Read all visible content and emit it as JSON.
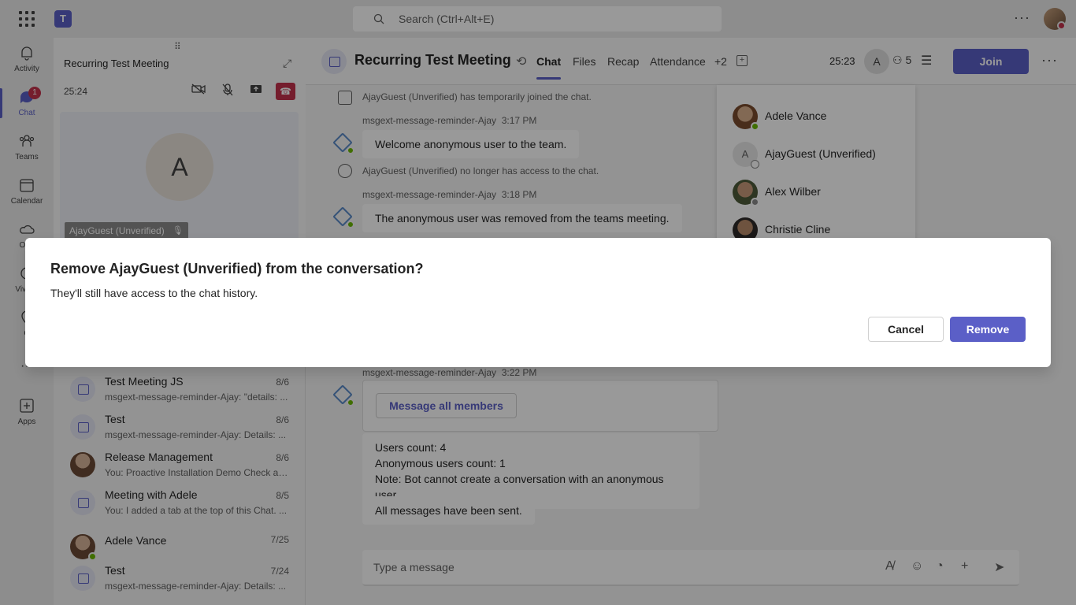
{
  "topbar": {
    "search_placeholder": "Search (Ctrl+Alt+E)",
    "more_label": "···"
  },
  "rail": {
    "items": [
      {
        "label": "Activity",
        "icon": "bell-icon"
      },
      {
        "label": "Chat",
        "icon": "chat-icon",
        "badge": "1"
      },
      {
        "label": "Teams",
        "icon": "teams-icon"
      },
      {
        "label": "Calendar",
        "icon": "calendar-icon"
      },
      {
        "label": "One",
        "icon": "cloud-icon"
      },
      {
        "label": "Viva C",
        "icon": "viva-icon"
      },
      {
        "label": "C",
        "icon": "calls-icon"
      },
      {
        "label": "···",
        "icon": "more-icon"
      },
      {
        "label": "Apps",
        "icon": "apps-icon"
      }
    ]
  },
  "meeting_card": {
    "title": "Recurring Test Meeting",
    "time": "25:24",
    "avatar_initial": "A",
    "participant_name": "AjayGuest (Unverified)"
  },
  "chat_list": [
    {
      "name": "Test Meeting JS",
      "date": "8/6",
      "preview": "msgext-message-reminder-Ajay: \"details: ..."
    },
    {
      "name": "Test",
      "date": "8/6",
      "preview": "msgext-message-reminder-Ajay: Details: ..."
    },
    {
      "name": "Release Management",
      "date": "8/6",
      "preview": "You: Proactive Installation Demo Check an..."
    },
    {
      "name": "Meeting with Adele",
      "date": "8/5",
      "preview": "You: I added a tab at the top of this Chat. ..."
    },
    {
      "name": "Adele Vance",
      "date": "7/25",
      "preview": ""
    },
    {
      "name": "Test",
      "date": "7/24",
      "preview": "msgext-message-reminder-Ajay: Details: ..."
    }
  ],
  "header": {
    "title": "Recurring Test Meeting",
    "tabs": [
      "Chat",
      "Files",
      "Recap",
      "Attendance",
      "+2"
    ],
    "timer": "25:23",
    "avatar_initial": "A",
    "people_count": "5",
    "join_label": "Join"
  },
  "conversation": {
    "sys1": "AjayGuest (Unverified) has temporarily joined the chat.",
    "sender1": "msgext-message-reminder-Ajay",
    "time1": "3:17 PM",
    "msg1": "Welcome anonymous user to the team.",
    "sys2": "AjayGuest (Unverified) no longer has access to the chat.",
    "sender2": "msgext-message-reminder-Ajay",
    "time2": "3:18 PM",
    "msg2": "The anonymous user was removed from the teams meeting.",
    "sender3": "msgext-message-reminder-Ajay",
    "time3": "3:22 PM",
    "card_button": "Message all members",
    "count_lines": [
      "Users count: 4",
      "Anonymous users count: 1",
      "Note: Bot cannot create a conversation with an anonymous user."
    ],
    "msg_final": "All messages have been sent."
  },
  "compose": {
    "placeholder": "Type a message"
  },
  "participants": [
    {
      "name": "Adele Vance",
      "status_color": "#6bb700"
    },
    {
      "name": "AjayGuest (Unverified)",
      "status_color": "#ffffff"
    },
    {
      "name": "Alex Wilber",
      "status_color": "#8a8a8a"
    },
    {
      "name": "Christie Cline",
      "status_color": "#6bb700"
    }
  ],
  "dialog": {
    "title": "Remove AjayGuest (Unverified) from the conversation?",
    "body": "They'll still have access to the chat history.",
    "cancel_label": "Cancel",
    "remove_label": "Remove"
  },
  "colors": {
    "accent": "#5b5fc7",
    "danger": "#c4314b",
    "available": "#6bb700"
  }
}
